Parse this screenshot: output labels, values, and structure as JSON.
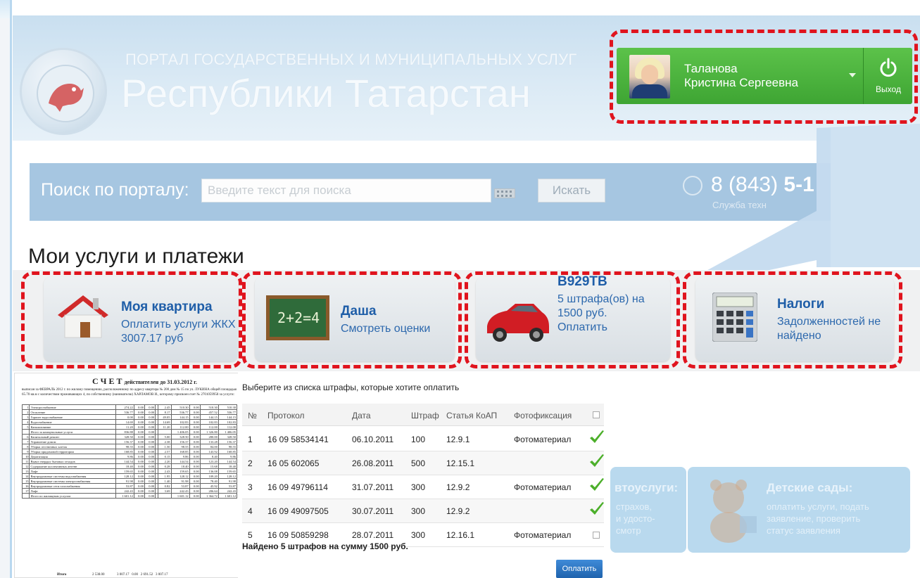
{
  "header": {
    "portal_line1": "ПОРТАЛ ГОСУДАРСТВЕННЫХ И МУНИЦИПАЛЬНЫХ УСЛУГ",
    "portal_line2": "Республики Татарстан",
    "user": {
      "last_name": "Таланова",
      "first_names": "Кристина Сергеевна"
    },
    "logout_label": "Выход"
  },
  "search": {
    "label": "Поиск по порталу:",
    "placeholder": "Введите текст для поиска",
    "button": "Искать",
    "phone_prefix": "8 (843) ",
    "phone_bold": "5-1",
    "phone_sub": "Служба техн"
  },
  "section": {
    "title": "Мои услуги и платежи",
    "cards": [
      {
        "title": "Моя квартира",
        "lines": [
          "Оплатить услуги ЖКХ",
          "3007.17 руб"
        ]
      },
      {
        "title": "Даша",
        "lines": [
          "Смотреть оценки"
        ],
        "board_text": "2+2=4"
      },
      {
        "title": "В929ТВ",
        "lines": [
          "5 штрафа(ов) на",
          "1500 руб.",
          "Оплатить"
        ]
      },
      {
        "title": "Налоги",
        "lines": [
          "Задолженностей не",
          "найдено"
        ]
      }
    ]
  },
  "invoice": {
    "title": "С Ч Е Т",
    "title_suffix": "действителен до 31.03.2012 г.",
    "text": "выписан за ФЕВРАЛЬ 2012 г. по жилому помещению, расположенному по адресу квартира № 200 дом № 15 по ул. ЛУКИНА общей площадью 65.70 кв.м с количеством проживающих 4, по собственнику (нанимателю) ХАРЛАМОВ И., которому присвоен счет № 2701059958 за услуги:",
    "rows": [
      [
        "1",
        "Электроснабжение",
        "274.22",
        "0.00",
        "0.00",
        "",
        "2.45",
        "510.30",
        "0.00",
        "510.30",
        "510.30"
      ],
      [
        "2",
        "Отопление",
        "536.77",
        "0.00",
        "0.00",
        "",
        "8.17",
        "536.77",
        "0.00",
        "457.52",
        "536.77"
      ],
      [
        "3",
        "Горячее водоснабжение",
        "0.00",
        "0.00",
        "0.00",
        "",
        "49.05",
        "144.15",
        "0.00",
        "144.15",
        "144.15"
      ],
      [
        "4",
        "Водоснабжение",
        "14.69",
        "0.00",
        "0.00",
        "",
        "14.69",
        "102.83",
        "0.00",
        "102.83",
        "102.83"
      ],
      [
        "5",
        "Канализование",
        "11.20",
        "0.00",
        "0.00",
        "",
        "11.20",
        "112.00",
        "0.00",
        "112.00",
        "112.00"
      ],
      [
        "",
        "Итого за коммунальные услуги",
        "836.88",
        "0.00",
        "0.00",
        "",
        "",
        "1 406.05",
        "0.00",
        "1 326.80",
        "1 406.05"
      ],
      [
        "6",
        "Капитальный ремонт",
        "328.50",
        "0.00",
        "0.00",
        "",
        "5.00",
        "328.50",
        "0.00",
        "280.00",
        "328.50"
      ],
      [
        "7",
        "Управление домом",
        "156.37",
        "0.00",
        "0.00",
        "",
        "2.38",
        "156.37",
        "0.00",
        "133.28",
        "156.37"
      ],
      [
        "8",
        "Уборка лестничных клеток",
        "98.55",
        "0.00",
        "0.00",
        "",
        "1.50",
        "98.55",
        "0.00",
        "84.00",
        "98.55"
      ],
      [
        "9",
        "Уборка придомовой территории",
        "168.85",
        "0.00",
        "0.00",
        "",
        "2.57",
        "168.85",
        "0.00",
        "143.92",
        "168.85"
      ],
      [
        "10",
        "Дератизация",
        "9.86",
        "0.00",
        "0.00",
        "",
        "0.15",
        "9.86",
        "0.00",
        "8.40",
        "9.86"
      ],
      [
        "11",
        "Вывоз твердых бытовых отходов",
        "144.54",
        "0.00",
        "0.00",
        "",
        "2.20",
        "144.54",
        "0.00",
        "123.20",
        "144.54"
      ],
      [
        "12",
        "Содержание коллективных антенн",
        "18.40",
        "0.00",
        "0.00",
        "",
        "0.28",
        "18.40",
        "0.00",
        "15.68",
        "18.40"
      ],
      [
        "13",
        "Лифт",
        "159.65",
        "0.00",
        "0.00",
        "",
        "2.43",
        "159.65",
        "0.00",
        "136.08",
        "159.65"
      ],
      [
        "14",
        "Внутридомовые системы водоснабжения",
        "128.12",
        "0.00",
        "0.00",
        "",
        "1.95",
        "128.12",
        "0.00",
        "109.20",
        "128.12"
      ],
      [
        "15",
        "Внутридомовые системы электроснабжения",
        "91.98",
        "0.00",
        "0.00",
        "",
        "1.40",
        "91.98",
        "0.00",
        "78.40",
        "91.98"
      ],
      [
        "16",
        "Внутридомовые сети газоснабжения",
        "53.87",
        "0.00",
        "0.00",
        "",
        "0.82",
        "53.87",
        "0.00",
        "45.92",
        "53.87"
      ],
      [
        "17",
        "Лифт",
        "242.43",
        "0.00",
        "0.00",
        "",
        "3.69",
        "242.43",
        "0.00",
        "206.64",
        "242.43"
      ],
      [
        "",
        "Итого по жилищным услугам",
        "1 601.12",
        "0.00",
        "0.00",
        "",
        "",
        "1 601.12",
        "0.00",
        "1 364.72",
        "1 601.12"
      ]
    ],
    "total_label": "Итого",
    "total": [
      "2 538.00",
      "3 007.17",
      "0.00",
      "2 691.52",
      "3 007.17"
    ]
  },
  "fines": {
    "caption": "Выберите из списка штрафы, которые хотите оплатить",
    "headers": [
      "№",
      "Протокол",
      "Дата",
      "Штраф",
      "Статья КоАП",
      "Фотофиксация"
    ],
    "rows": [
      {
        "n": "1",
        "protocol": "16 09 58534141",
        "date": "06.10.2011",
        "fine": "100",
        "article": "12.9.1",
        "photo": "Фотоматериал",
        "checked": true
      },
      {
        "n": "2",
        "protocol": "16 05 602065",
        "date": "26.08.2011",
        "fine": "500",
        "article": "12.15.1",
        "photo": "",
        "checked": true
      },
      {
        "n": "3",
        "protocol": "16 09 49796114",
        "date": "31.07.2011",
        "fine": "300",
        "article": "12.9.2",
        "photo": "Фотоматериал",
        "checked": true
      },
      {
        "n": "4",
        "protocol": "16 09 49097505",
        "date": "30.07.2011",
        "fine": "300",
        "article": "12.9.2",
        "photo": "",
        "checked": true
      },
      {
        "n": "5",
        "protocol": "16 09 50859298",
        "date": "28.07.2011",
        "fine": "300",
        "article": "12.16.1",
        "photo": "Фотоматериал",
        "checked": false
      }
    ],
    "total": "Найдено 5 штрафов на сумму 1500 руб.",
    "pay_button": "Оплатить"
  },
  "background_tiles": {
    "auto": {
      "title": "втоуслуги:",
      "lines": [
        "страхов,",
        "и удосто-",
        "смотр"
      ]
    },
    "kindergarten": {
      "title": "Детские сады:",
      "lines": [
        "оплатить услуги, подать",
        "заявление, проверить",
        "статус заявления"
      ]
    }
  }
}
